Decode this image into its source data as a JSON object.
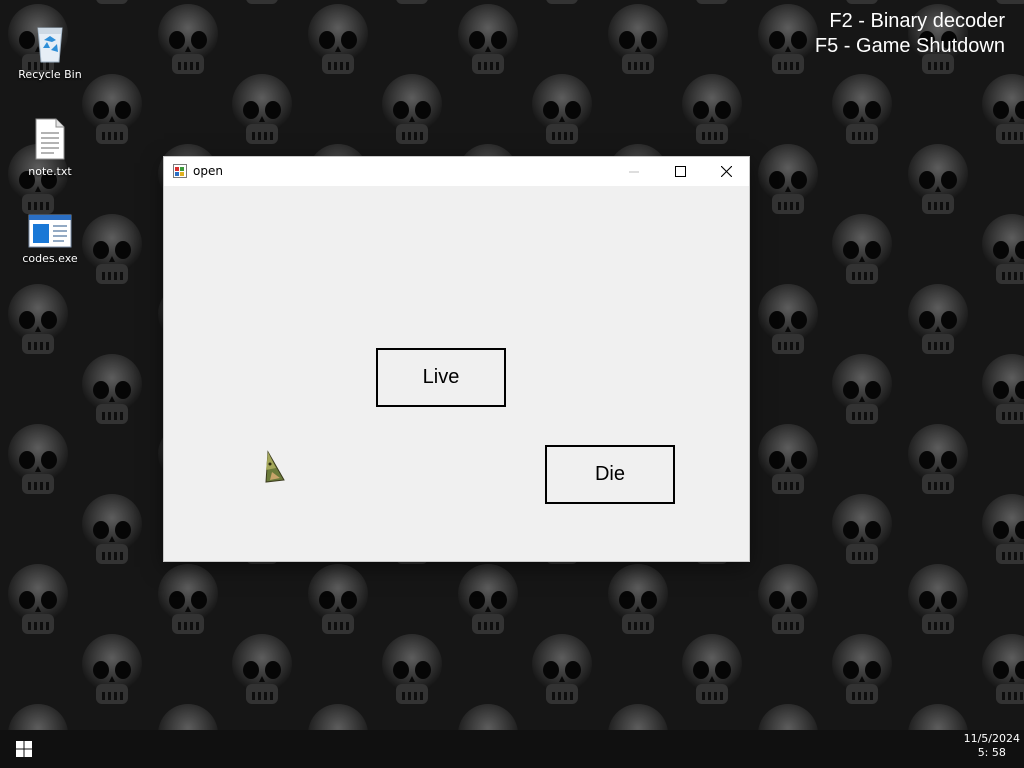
{
  "overlay": {
    "line1": "F2 - Binary decoder",
    "line2": "F5 - Game Shutdown"
  },
  "desktop_icons": [
    {
      "label": "Recycle Bin",
      "icon": "recycle-bin-icon"
    },
    {
      "label": "note.txt",
      "icon": "text-file-icon"
    },
    {
      "label": "codes.exe",
      "icon": "app-window-icon"
    }
  ],
  "window": {
    "title": "open",
    "buttons": {
      "live": "Live",
      "die": "Die"
    }
  },
  "taskbar": {
    "date": "11/5/2024",
    "time": "5: 58"
  },
  "colors": {
    "window_bg": "#f0f0f0",
    "titlebar_bg": "#ffffff",
    "taskbar_bg": "#101010",
    "wallpaper_dark": "#1b1b1b"
  }
}
